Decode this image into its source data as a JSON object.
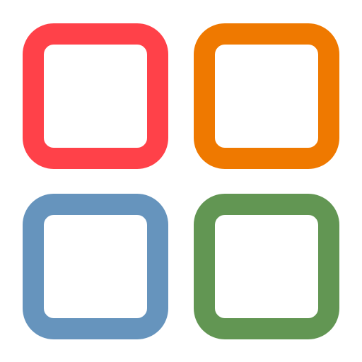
{
  "icon": {
    "name": "app-grid-icon",
    "tiles": [
      {
        "name": "top-left-tile",
        "color": "#ff4149"
      },
      {
        "name": "top-right-tile",
        "color": "#ef7900"
      },
      {
        "name": "bottom-left-tile",
        "color": "#6694bd"
      },
      {
        "name": "bottom-right-tile",
        "color": "#629653"
      }
    ]
  }
}
